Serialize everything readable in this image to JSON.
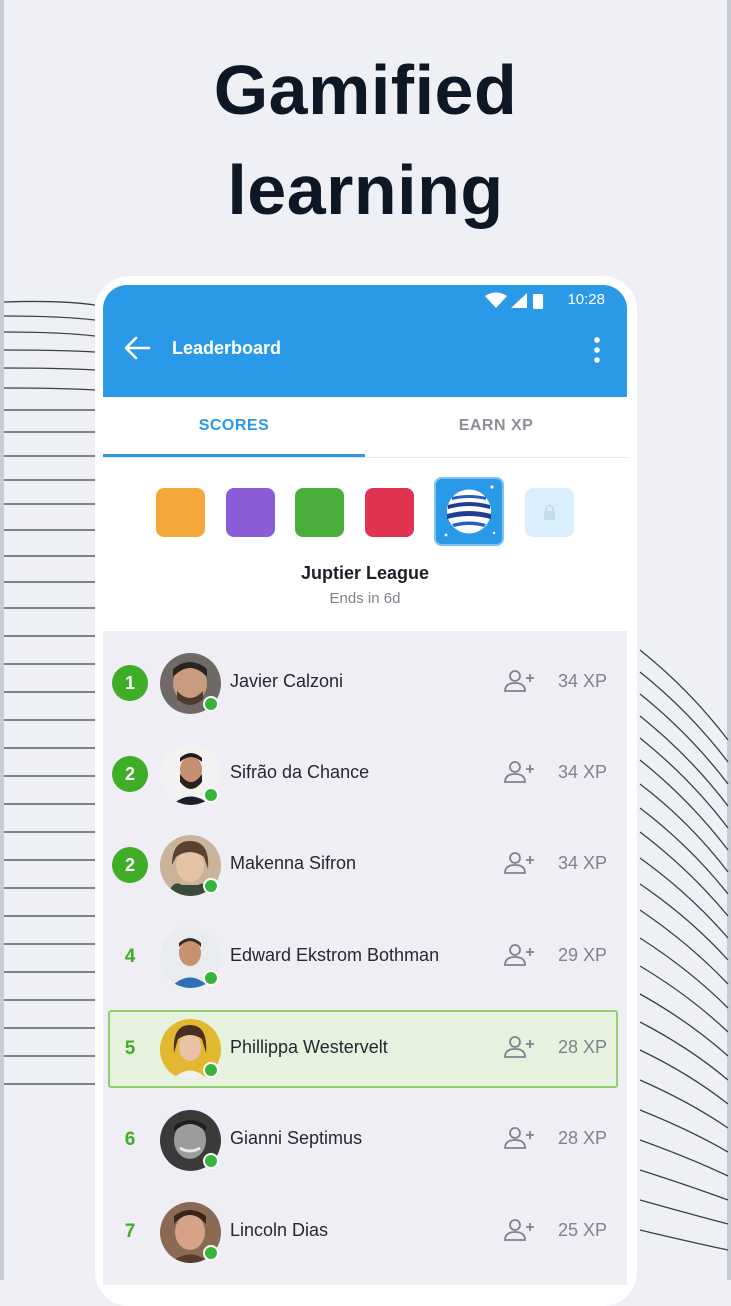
{
  "headline": {
    "line1": "Gamified",
    "line2": "learning"
  },
  "status_bar": {
    "time": "10:28"
  },
  "app_bar": {
    "title": "Leaderboard"
  },
  "tabs": [
    {
      "label": "SCORES",
      "selected": true
    },
    {
      "label": "EARN XP",
      "selected": false
    }
  ],
  "league": {
    "badges": [
      {
        "color": "#f5a83a"
      },
      {
        "color": "#8a5dd6"
      },
      {
        "color": "#4aae3a"
      },
      {
        "color": "#e0334f"
      },
      {
        "color": "#2a99e8",
        "selected": true,
        "icon": "jupiter-planet-icon"
      },
      {
        "color": "#dbeefb",
        "locked": true,
        "icon": "lock-icon"
      }
    ],
    "name": "Juptier League",
    "ends": "Ends in 6d"
  },
  "leaderboard": [
    {
      "rank": "1",
      "name": "Javier Calzoni",
      "xp": "34 XP",
      "top": true
    },
    {
      "rank": "2",
      "name": "Sifrão da Chance",
      "xp": "34 XP",
      "top": true
    },
    {
      "rank": "2",
      "name": "Makenna Sifron",
      "xp": "34 XP",
      "top": true
    },
    {
      "rank": "4",
      "name": "Edward Ekstrom Bothman",
      "xp": "29 XP"
    },
    {
      "rank": "5",
      "name": "Phillippa Westervelt",
      "xp": "28 XP",
      "current_user": true
    },
    {
      "rank": "6",
      "name": "Gianni Septimus",
      "xp": "28 XP"
    },
    {
      "rank": "7",
      "name": "Lincoln Dias",
      "xp": "25 XP"
    }
  ],
  "colors": {
    "primary": "#2a99e8",
    "rank_green": "#3fad26",
    "online": "#39b43a",
    "highlight_border": "#8fd06b"
  }
}
